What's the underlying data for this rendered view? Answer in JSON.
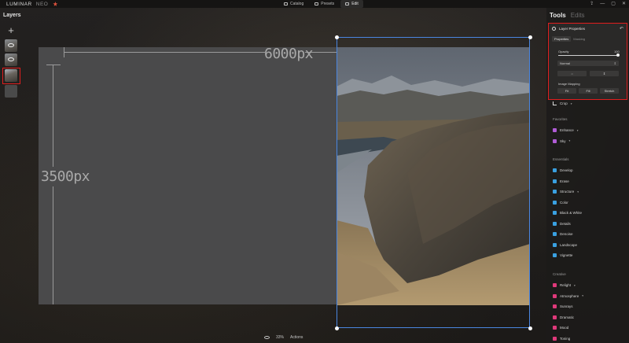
{
  "app": {
    "logo_main": "LUMINAR",
    "logo_sub": "NEO"
  },
  "topnav": {
    "tabs": [
      {
        "label": "Catalog"
      },
      {
        "label": "Presets"
      },
      {
        "label": "Edit",
        "active": true
      }
    ]
  },
  "window_controls": [
    "⇪",
    "—",
    "▢",
    "✕"
  ],
  "layers": {
    "title": "Layers",
    "add_label": "+"
  },
  "canvas": {
    "width_label": "6000px",
    "height_label": "3500px"
  },
  "bottombar": {
    "zoom": "33%",
    "actions": "Actions"
  },
  "right_panel": {
    "tabs": {
      "tools": "Tools",
      "edits": "Edits"
    },
    "layer_properties": {
      "title": "Layer Properties",
      "subtabs": [
        "Properties",
        "Masking"
      ],
      "opacity_label": "Opacity",
      "opacity_value": "100",
      "opacity_fraction": 1.0,
      "blend_mode": "Normal",
      "flip_buttons": [
        "⇔",
        "⇕"
      ],
      "image_mapping_label": "Image Mapping",
      "mapping_buttons": [
        "Fit",
        "Fill",
        "Stretch"
      ]
    },
    "crop": {
      "label": "Crop"
    },
    "favorites": {
      "title": "Favorites",
      "items": [
        {
          "label": "Enhance",
          "color": "#b05cd6",
          "chev": true
        },
        {
          "label": "Sky",
          "color": "#b05cd6",
          "chev": true
        }
      ]
    },
    "essentials": {
      "title": "Essentials",
      "items": [
        {
          "label": "Develop",
          "color": "#3aa0e0"
        },
        {
          "label": "Erase",
          "color": "#3aa0e0"
        },
        {
          "label": "Structure",
          "color": "#3aa0e0",
          "chev": true
        },
        {
          "label": "Color",
          "color": "#3aa0e0"
        },
        {
          "label": "Black & White",
          "color": "#3aa0e0"
        },
        {
          "label": "Details",
          "color": "#3aa0e0"
        },
        {
          "label": "Denoise",
          "color": "#3aa0e0"
        },
        {
          "label": "Landscape",
          "color": "#3aa0e0"
        },
        {
          "label": "Vignette",
          "color": "#3aa0e0"
        }
      ]
    },
    "creative": {
      "title": "Creative",
      "items": [
        {
          "label": "Relight",
          "color": "#e0397a",
          "chev": true
        },
        {
          "label": "Atmosphere",
          "color": "#e0397a",
          "chev": true
        },
        {
          "label": "Sunrays",
          "color": "#e0397a"
        },
        {
          "label": "Dramatic",
          "color": "#e0397a"
        },
        {
          "label": "Mood",
          "color": "#e0397a"
        },
        {
          "label": "Toning",
          "color": "#e0397a"
        }
      ]
    }
  },
  "colors": {
    "selection_highlight": "#e01e1e",
    "frame_blue": "#4a86e0"
  }
}
